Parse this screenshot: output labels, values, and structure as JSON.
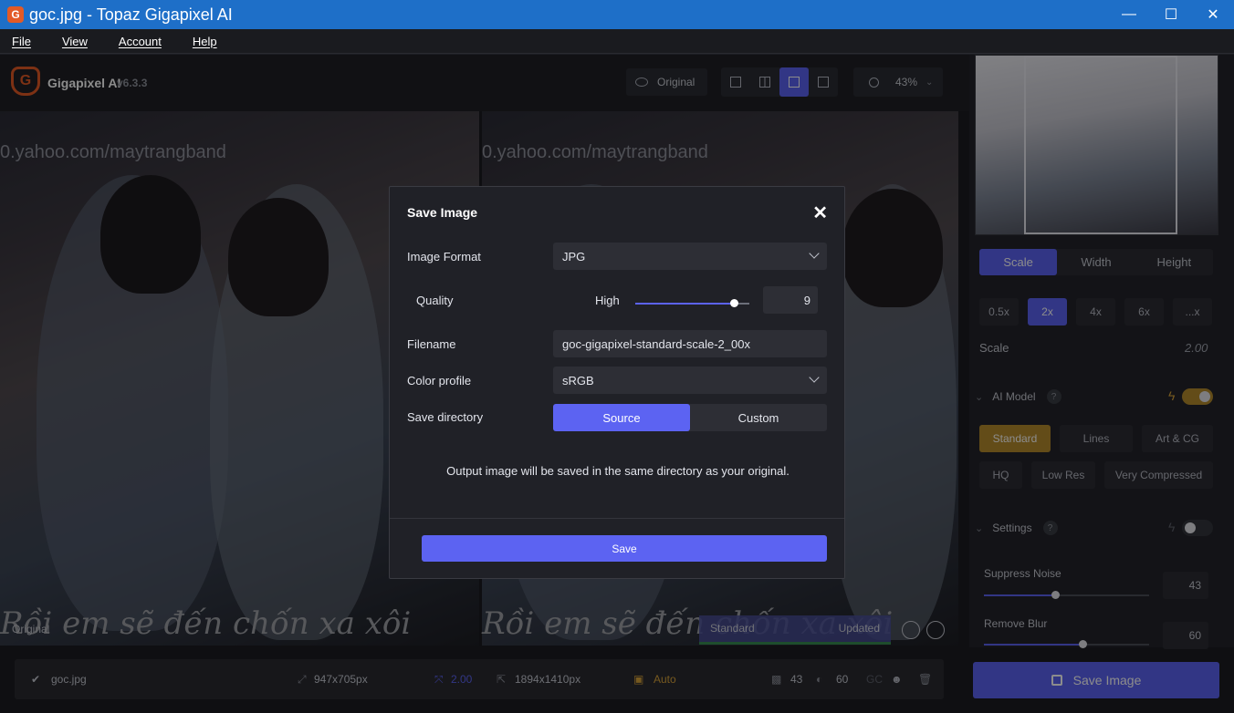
{
  "window": {
    "title": "goc.jpg - Topaz Gigapixel AI",
    "min": "—",
    "max": "☐",
    "close": "✕"
  },
  "menu": [
    "File",
    "View",
    "Account",
    "Help"
  ],
  "toolbar": {
    "app_name": "Gigapixel AI",
    "version": "v6.3.3",
    "original_label": "Original",
    "zoom": "43%"
  },
  "canvas": {
    "watermark": "0.yahoo.com/maytrangband",
    "bottom_text": "Rồi em sẽ đến chốn xa xôi",
    "caption_original": "Original",
    "caption_model": "Standard",
    "caption_updated": "Updated"
  },
  "dialog": {
    "title": "Save Image",
    "image_format_label": "Image Format",
    "image_format_value": "JPG",
    "quality_label": "Quality",
    "quality_level": "High",
    "quality_value": "9",
    "quality_fraction": 0.86,
    "filename_label": "Filename",
    "filename_value": "goc-gigapixel-standard-scale-2_00x",
    "color_profile_label": "Color profile",
    "color_profile_value": "sRGB",
    "save_directory_label": "Save directory",
    "dir_options": [
      "Source",
      "Custom"
    ],
    "dir_selected": "Source",
    "note": "Output image will be saved in the same directory as your original.",
    "save_label": "Save"
  },
  "right_panel": {
    "size_tabs": [
      "Scale",
      "Width",
      "Height"
    ],
    "scale_options": [
      "0.5x",
      "2x",
      "4x",
      "6x",
      "...x"
    ],
    "scale_label": "Scale",
    "scale_value": "2.00",
    "ai_model_label": "AI Model",
    "models_row1": [
      "Standard",
      "Lines",
      "Art & CG"
    ],
    "models_row2": [
      "HQ",
      "Low Res",
      "Very Compressed"
    ],
    "settings_label": "Settings",
    "suppress_noise_label": "Suppress Noise",
    "suppress_noise_value": "43",
    "remove_blur_label": "Remove Blur",
    "remove_blur_value": "60",
    "save_image_label": "Save Image"
  },
  "bottom": {
    "filename": "goc.jpg",
    "input_size": "947x705px",
    "scale": "2.00",
    "output_size": "1894x1410px",
    "mode": "Auto",
    "noise": "43",
    "blur": "60",
    "gc": "GC"
  },
  "help_glyph": "?",
  "colors": {
    "accent": "#5c63f2",
    "model_selected": "#b48a2c",
    "titlebar": "#1e6fc8"
  }
}
